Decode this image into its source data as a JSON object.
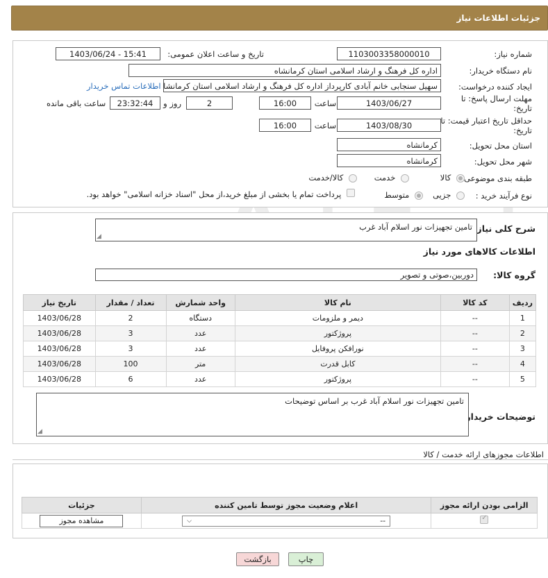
{
  "page_title": "جزئیات اطلاعات نیاز",
  "form": {
    "need_number_label": "شماره نیاز:",
    "need_number": "1103003358000010",
    "announce_label": "تاریخ و ساعت اعلان عمومی:",
    "announce_value": "1403/06/24 - 15:41",
    "buyer_org_label": "نام دستگاه خریدار:",
    "buyer_org": "اداره کل فرهنگ و ارشاد اسلامی استان کرمانشاه",
    "creator_label": "ایجاد کننده درخواست:",
    "creator": "سهیل سنجابی خانم آبادی کارپرداز اداره کل فرهنگ و ارشاد اسلامی استان کرمانشاه",
    "contact_link": "اطلاعات تماس خریدار",
    "reply_deadline_label": "مهلت ارسال پاسخ: تا تاریخ:",
    "reply_date": "1403/06/27",
    "time_label": "ساعت",
    "reply_time": "16:00",
    "days_count": "2",
    "days_label": "روز و",
    "remaining_time": "23:32:44",
    "remaining_label": "ساعت باقی مانده",
    "validity_label": "حداقل تاریخ اعتبار قیمت: تا تاریخ:",
    "validity_date": "1403/08/30",
    "validity_time": "16:00",
    "province_label": "استان محل تحویل:",
    "province": "کرمانشاه",
    "city_label": "شهر محل تحویل:",
    "city": "کرمانشاه",
    "category_label": "طبقه بندی موضوعی:",
    "category_options": [
      "کالا",
      "خدمت",
      "کالا/خدمت"
    ],
    "process_label": "نوع فرآیند خرید :",
    "process_options": [
      "جزیی",
      "متوسط"
    ],
    "payment_note": "پرداخت تمام یا بخشی از مبلغ خرید،از محل \"اسناد خزانه اسلامی\" خواهد بود."
  },
  "summary": {
    "label": "شرح کلی نیاز:",
    "value": "تامین تجهیزات نور اسلام آباد غرب"
  },
  "items_section": {
    "title": "اطلاعات کالاهای مورد نیاز",
    "group_label": "گروه کالا:",
    "group_value": "دوربین،صوتی و تصویر",
    "columns": [
      "ردیف",
      "کد کالا",
      "نام کالا",
      "واحد شمارش",
      "تعداد / مقدار",
      "تاریخ نیاز"
    ],
    "rows": [
      {
        "row": "1",
        "code": "--",
        "name": "دیمر و ملزومات",
        "unit": "دستگاه",
        "qty": "2",
        "date": "1403/06/28"
      },
      {
        "row": "2",
        "code": "--",
        "name": "پروژکتور",
        "unit": "عدد",
        "qty": "3",
        "date": "1403/06/28"
      },
      {
        "row": "3",
        "code": "--",
        "name": "نورافکن پروفایل",
        "unit": "عدد",
        "qty": "3",
        "date": "1403/06/28"
      },
      {
        "row": "4",
        "code": "--",
        "name": "کابل قدرت",
        "unit": "متر",
        "qty": "100",
        "date": "1403/06/28"
      },
      {
        "row": "5",
        "code": "--",
        "name": "پروژکتور",
        "unit": "عدد",
        "qty": "6",
        "date": "1403/06/28"
      }
    ]
  },
  "buyer_notes": {
    "label": "توضیحات خریدار:",
    "value": "تامین تجهیزات نور اسلام آباد غرب بر اساس توضیحات"
  },
  "permits": {
    "title": "اطلاعات مجوزهای ارائه خدمت / کالا",
    "columns": [
      "الزامی بودن ارائه مجوز",
      "اعلام وضعیت مجوز توسط تامین کننده",
      "جزئیات"
    ],
    "select_value": "--",
    "view_button": "مشاهده مجوز"
  },
  "buttons": {
    "print": "چاپ",
    "back": "بازگشت"
  },
  "watermark": "AriaTender.neT",
  "colors": {
    "header": "#a38349",
    "back_button": "#f7d7d7",
    "print_button": "#d9efd6",
    "link": "#2a6ebb"
  }
}
